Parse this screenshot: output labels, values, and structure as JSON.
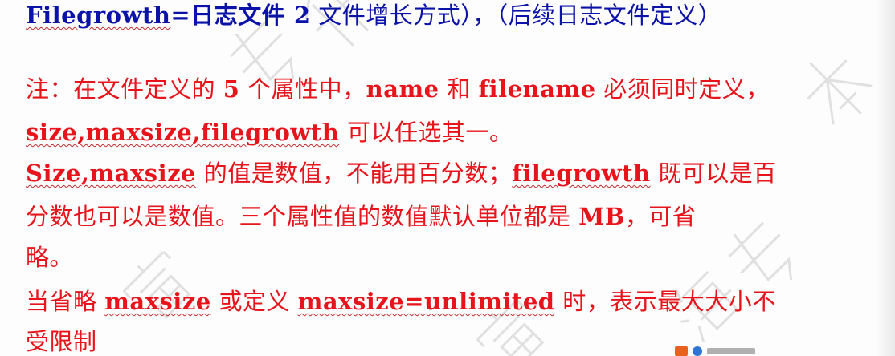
{
  "lines": {
    "l1": {
      "term": "Filegrowth",
      "text1": "=日志文件 ",
      "num": "2",
      "text2": " 文件增长方式），（后续日志文件定义）"
    },
    "l2": {
      "text1": "注：在文件定义的 ",
      "num": "5",
      "text2": " 个属性中，",
      "name": "name",
      "and": " 和 ",
      "filename": "filename",
      "text3": " 必须同时定义，"
    },
    "l3": {
      "term": "size,maxsize,filegrowth",
      "text": " 可以任选其一。"
    },
    "l4": {
      "term1": "Size,maxsize",
      "text1": " 的值是数值，不能用百分数；",
      "term2": "filegrowth",
      "text2": " 既可以是百"
    },
    "l5": {
      "text1": "分数也可以是数值。三个属性值的数值默认单位都是 ",
      "mb": "MB",
      "text2": "，可省"
    },
    "l6": {
      "text": "略。"
    },
    "l7": {
      "text1": "当省略 ",
      "term1": "maxsize",
      "text2": " 或定义 ",
      "term2": "maxsize=unlimited",
      "text3": " 时，表示最大大小不"
    },
    "l8": {
      "text": "受限制"
    }
  },
  "colors": {
    "blue": "#0b12a8",
    "red": "#e8141b"
  }
}
